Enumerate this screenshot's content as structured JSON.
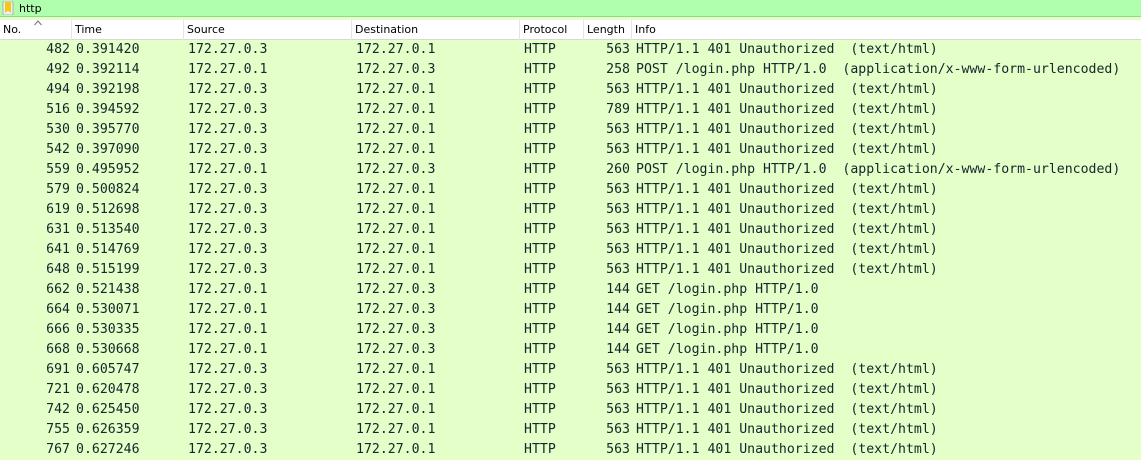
{
  "filter": {
    "value": "http",
    "icon": "bookmark-icon",
    "color": "#afffaf"
  },
  "columns": {
    "no": "No.",
    "time": "Time",
    "source": "Source",
    "destination": "Destination",
    "protocol": "Protocol",
    "length": "Length",
    "info": "Info"
  },
  "row_color": "#e4ffc7",
  "packets": [
    {
      "no": "482",
      "time": "0.391420",
      "src": "172.27.0.3",
      "dst": "172.27.0.1",
      "proto": "HTTP",
      "len": "563",
      "info": "HTTP/1.1 401 Unauthorized  (text/html)"
    },
    {
      "no": "492",
      "time": "0.392114",
      "src": "172.27.0.1",
      "dst": "172.27.0.3",
      "proto": "HTTP",
      "len": "258",
      "info": "POST /login.php HTTP/1.0  (application/x-www-form-urlencoded)"
    },
    {
      "no": "494",
      "time": "0.392198",
      "src": "172.27.0.3",
      "dst": "172.27.0.1",
      "proto": "HTTP",
      "len": "563",
      "info": "HTTP/1.1 401 Unauthorized  (text/html)"
    },
    {
      "no": "516",
      "time": "0.394592",
      "src": "172.27.0.3",
      "dst": "172.27.0.1",
      "proto": "HTTP",
      "len": "789",
      "info": "HTTP/1.1 401 Unauthorized  (text/html)"
    },
    {
      "no": "530",
      "time": "0.395770",
      "src": "172.27.0.3",
      "dst": "172.27.0.1",
      "proto": "HTTP",
      "len": "563",
      "info": "HTTP/1.1 401 Unauthorized  (text/html)"
    },
    {
      "no": "542",
      "time": "0.397090",
      "src": "172.27.0.3",
      "dst": "172.27.0.1",
      "proto": "HTTP",
      "len": "563",
      "info": "HTTP/1.1 401 Unauthorized  (text/html)"
    },
    {
      "no": "559",
      "time": "0.495952",
      "src": "172.27.0.1",
      "dst": "172.27.0.3",
      "proto": "HTTP",
      "len": "260",
      "info": "POST /login.php HTTP/1.0  (application/x-www-form-urlencoded)"
    },
    {
      "no": "579",
      "time": "0.500824",
      "src": "172.27.0.3",
      "dst": "172.27.0.1",
      "proto": "HTTP",
      "len": "563",
      "info": "HTTP/1.1 401 Unauthorized  (text/html)"
    },
    {
      "no": "619",
      "time": "0.512698",
      "src": "172.27.0.3",
      "dst": "172.27.0.1",
      "proto": "HTTP",
      "len": "563",
      "info": "HTTP/1.1 401 Unauthorized  (text/html)"
    },
    {
      "no": "631",
      "time": "0.513540",
      "src": "172.27.0.3",
      "dst": "172.27.0.1",
      "proto": "HTTP",
      "len": "563",
      "info": "HTTP/1.1 401 Unauthorized  (text/html)"
    },
    {
      "no": "641",
      "time": "0.514769",
      "src": "172.27.0.3",
      "dst": "172.27.0.1",
      "proto": "HTTP",
      "len": "563",
      "info": "HTTP/1.1 401 Unauthorized  (text/html)"
    },
    {
      "no": "648",
      "time": "0.515199",
      "src": "172.27.0.3",
      "dst": "172.27.0.1",
      "proto": "HTTP",
      "len": "563",
      "info": "HTTP/1.1 401 Unauthorized  (text/html)"
    },
    {
      "no": "662",
      "time": "0.521438",
      "src": "172.27.0.1",
      "dst": "172.27.0.3",
      "proto": "HTTP",
      "len": "144",
      "info": "GET /login.php HTTP/1.0"
    },
    {
      "no": "664",
      "time": "0.530071",
      "src": "172.27.0.1",
      "dst": "172.27.0.3",
      "proto": "HTTP",
      "len": "144",
      "info": "GET /login.php HTTP/1.0"
    },
    {
      "no": "666",
      "time": "0.530335",
      "src": "172.27.0.1",
      "dst": "172.27.0.3",
      "proto": "HTTP",
      "len": "144",
      "info": "GET /login.php HTTP/1.0"
    },
    {
      "no": "668",
      "time": "0.530668",
      "src": "172.27.0.1",
      "dst": "172.27.0.3",
      "proto": "HTTP",
      "len": "144",
      "info": "GET /login.php HTTP/1.0"
    },
    {
      "no": "691",
      "time": "0.605747",
      "src": "172.27.0.3",
      "dst": "172.27.0.1",
      "proto": "HTTP",
      "len": "563",
      "info": "HTTP/1.1 401 Unauthorized  (text/html)"
    },
    {
      "no": "721",
      "time": "0.620478",
      "src": "172.27.0.3",
      "dst": "172.27.0.1",
      "proto": "HTTP",
      "len": "563",
      "info": "HTTP/1.1 401 Unauthorized  (text/html)"
    },
    {
      "no": "742",
      "time": "0.625450",
      "src": "172.27.0.3",
      "dst": "172.27.0.1",
      "proto": "HTTP",
      "len": "563",
      "info": "HTTP/1.1 401 Unauthorized  (text/html)"
    },
    {
      "no": "755",
      "time": "0.626359",
      "src": "172.27.0.3",
      "dst": "172.27.0.1",
      "proto": "HTTP",
      "len": "563",
      "info": "HTTP/1.1 401 Unauthorized  (text/html)"
    },
    {
      "no": "767",
      "time": "0.627246",
      "src": "172.27.0.3",
      "dst": "172.27.0.1",
      "proto": "HTTP",
      "len": "563",
      "info": "HTTP/1.1 401 Unauthorized  (text/html)"
    }
  ]
}
